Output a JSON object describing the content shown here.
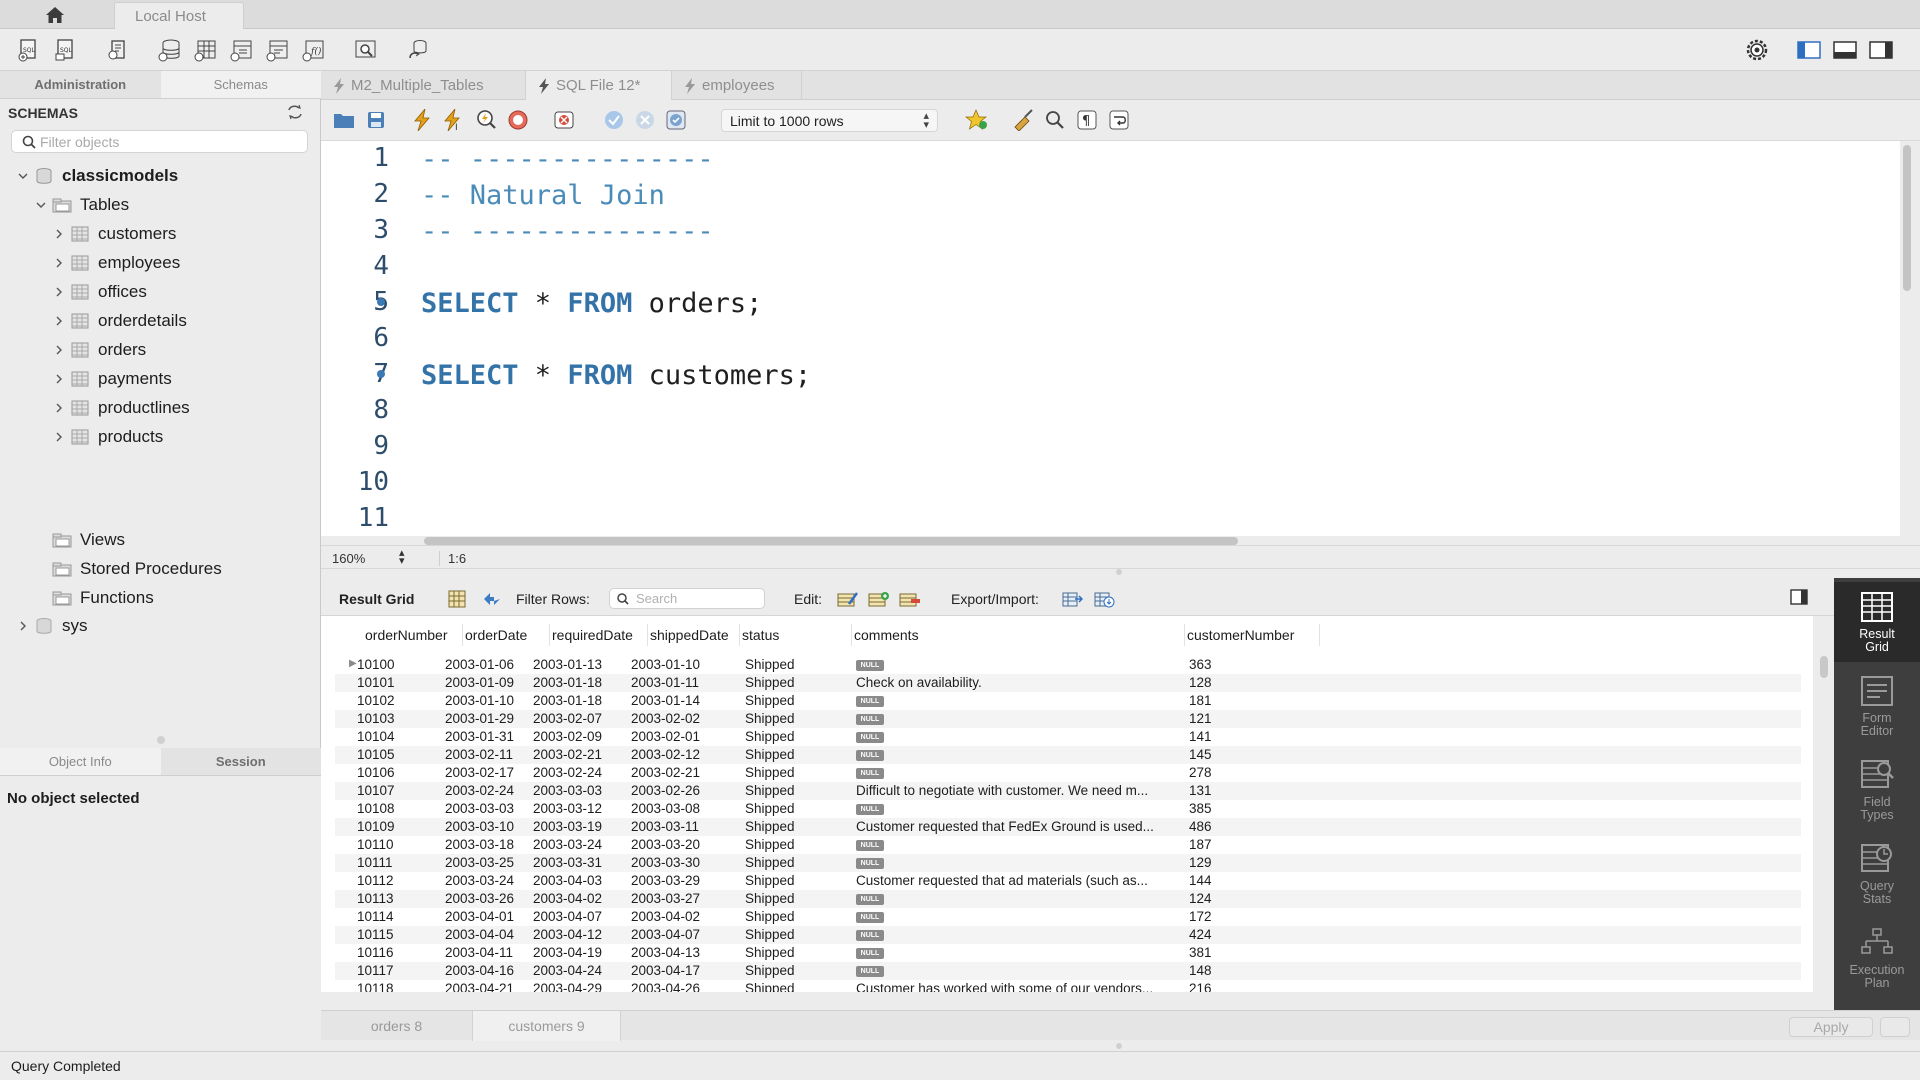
{
  "top_tab": {
    "connection_name": "Local Host"
  },
  "sidebar": {
    "tabs": [
      "Administration",
      "Schemas"
    ],
    "section_title": "SCHEMAS",
    "filter_placeholder": "Filter objects",
    "tree": {
      "schema": "classicmodels",
      "tables_label": "Tables",
      "tables": [
        "customers",
        "employees",
        "offices",
        "orderdetails",
        "orders",
        "payments",
        "productlines",
        "products"
      ],
      "views_label": "Views",
      "procedures_label": "Stored Procedures",
      "functions_label": "Functions",
      "other_schema": "sys"
    },
    "info_tabs": [
      "Object Info",
      "Session"
    ],
    "no_object": "No object selected"
  },
  "editor": {
    "tabs": [
      "M2_Multiple_Tables",
      "SQL File 12*",
      "employees"
    ],
    "limit_select": "Limit to 1000 rows",
    "lines": [
      "1",
      "2",
      "3",
      "4",
      "5",
      "6",
      "7",
      "8",
      "9",
      "10",
      "11"
    ],
    "code": {
      "l1": "-- ---------------",
      "l2": "-- Natural Join",
      "l3": "-- ---------------",
      "kw_select": "SELECT",
      "star": " * ",
      "kw_from": "FROM",
      "l5_rest": " orders;",
      "l7_rest": " customers;"
    },
    "zoom": "160%",
    "cursor": "1:6"
  },
  "result": {
    "label": "Result Grid",
    "filter_rows_label": "Filter Rows:",
    "search_placeholder": "Search",
    "edit_label": "Edit:",
    "export_label": "Export/Import:",
    "columns": [
      "orderNumber",
      "orderDate",
      "requiredDate",
      "shippedDate",
      "status",
      "comments",
      "customerNumber"
    ],
    "null_text": "NULL",
    "rows": [
      [
        "10100",
        "2003-01-06",
        "2003-01-13",
        "2003-01-10",
        "Shipped",
        null,
        "363"
      ],
      [
        "10101",
        "2003-01-09",
        "2003-01-18",
        "2003-01-11",
        "Shipped",
        "Check on availability.",
        "128"
      ],
      [
        "10102",
        "2003-01-10",
        "2003-01-18",
        "2003-01-14",
        "Shipped",
        null,
        "181"
      ],
      [
        "10103",
        "2003-01-29",
        "2003-02-07",
        "2003-02-02",
        "Shipped",
        null,
        "121"
      ],
      [
        "10104",
        "2003-01-31",
        "2003-02-09",
        "2003-02-01",
        "Shipped",
        null,
        "141"
      ],
      [
        "10105",
        "2003-02-11",
        "2003-02-21",
        "2003-02-12",
        "Shipped",
        null,
        "145"
      ],
      [
        "10106",
        "2003-02-17",
        "2003-02-24",
        "2003-02-21",
        "Shipped",
        null,
        "278"
      ],
      [
        "10107",
        "2003-02-24",
        "2003-03-03",
        "2003-02-26",
        "Shipped",
        "Difficult to negotiate with customer. We need m...",
        "131"
      ],
      [
        "10108",
        "2003-03-03",
        "2003-03-12",
        "2003-03-08",
        "Shipped",
        null,
        "385"
      ],
      [
        "10109",
        "2003-03-10",
        "2003-03-19",
        "2003-03-11",
        "Shipped",
        "Customer requested that FedEx Ground is used...",
        "486"
      ],
      [
        "10110",
        "2003-03-18",
        "2003-03-24",
        "2003-03-20",
        "Shipped",
        null,
        "187"
      ],
      [
        "10111",
        "2003-03-25",
        "2003-03-31",
        "2003-03-30",
        "Shipped",
        null,
        "129"
      ],
      [
        "10112",
        "2003-03-24",
        "2003-04-03",
        "2003-03-29",
        "Shipped",
        "Customer requested that ad materials (such as...",
        "144"
      ],
      [
        "10113",
        "2003-03-26",
        "2003-04-02",
        "2003-03-27",
        "Shipped",
        null,
        "124"
      ],
      [
        "10114",
        "2003-04-01",
        "2003-04-07",
        "2003-04-02",
        "Shipped",
        null,
        "172"
      ],
      [
        "10115",
        "2003-04-04",
        "2003-04-12",
        "2003-04-07",
        "Shipped",
        null,
        "424"
      ],
      [
        "10116",
        "2003-04-11",
        "2003-04-19",
        "2003-04-13",
        "Shipped",
        null,
        "381"
      ],
      [
        "10117",
        "2003-04-16",
        "2003-04-24",
        "2003-04-17",
        "Shipped",
        null,
        "148"
      ],
      [
        "10118",
        "2003-04-21",
        "2003-04-29",
        "2003-04-26",
        "Shipped",
        "Customer has worked with some of our vendors...",
        "216"
      ]
    ],
    "tabs": [
      "orders 8",
      "customers 9"
    ],
    "apply_label": "Apply"
  },
  "side_panel": [
    {
      "label_1": "Result",
      "label_2": "Grid",
      "icon": "result-grid-icon"
    },
    {
      "label_1": "Form",
      "label_2": "Editor",
      "icon": "form-editor-icon"
    },
    {
      "label_1": "Field",
      "label_2": "Types",
      "icon": "field-types-icon"
    },
    {
      "label_1": "Query",
      "label_2": "Stats",
      "icon": "query-stats-icon"
    },
    {
      "label_1": "Execution",
      "label_2": "Plan",
      "icon": "execution-plan-icon"
    }
  ],
  "status": "Query Completed",
  "colors": {
    "keyword": "#3473a8",
    "comment": "#4a8bb8",
    "bolt": "#e5a11c",
    "panel_dark": "#3e3e3e"
  }
}
